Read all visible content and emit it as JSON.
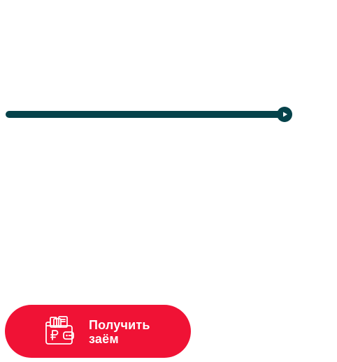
{
  "slider": {
    "value_fraction": 1.0,
    "track_color": "#e3eaea",
    "fill_color": "#05424a",
    "thumb_icon": "play-triangle-icon"
  },
  "cta": {
    "label": "Получить заём",
    "icon": "wallet-ruble-icon",
    "background_color": "#f01235",
    "text_color": "#ffffff"
  }
}
